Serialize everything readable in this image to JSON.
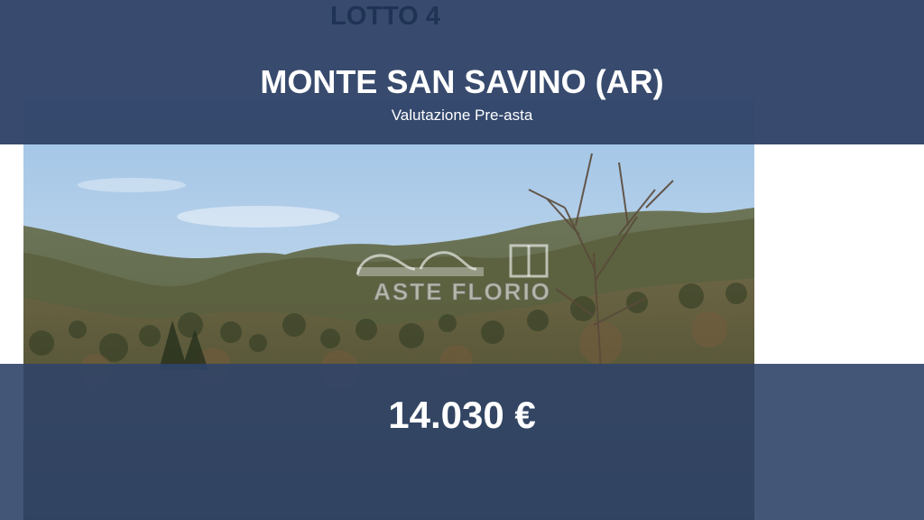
{
  "slide": {
    "lot_label": "LOTTO 4",
    "title": "MONTE SAN SAVINO (AR)",
    "subtitle": "Valutazione Pre-asta",
    "price": "14.030 €"
  },
  "photo": {
    "subject": "wooded-hills-landscape",
    "watermark_text": "ASTE FLORIO"
  },
  "colors": {
    "band": "#304468",
    "lot_label": "#1f3354",
    "text": "#ffffff"
  }
}
